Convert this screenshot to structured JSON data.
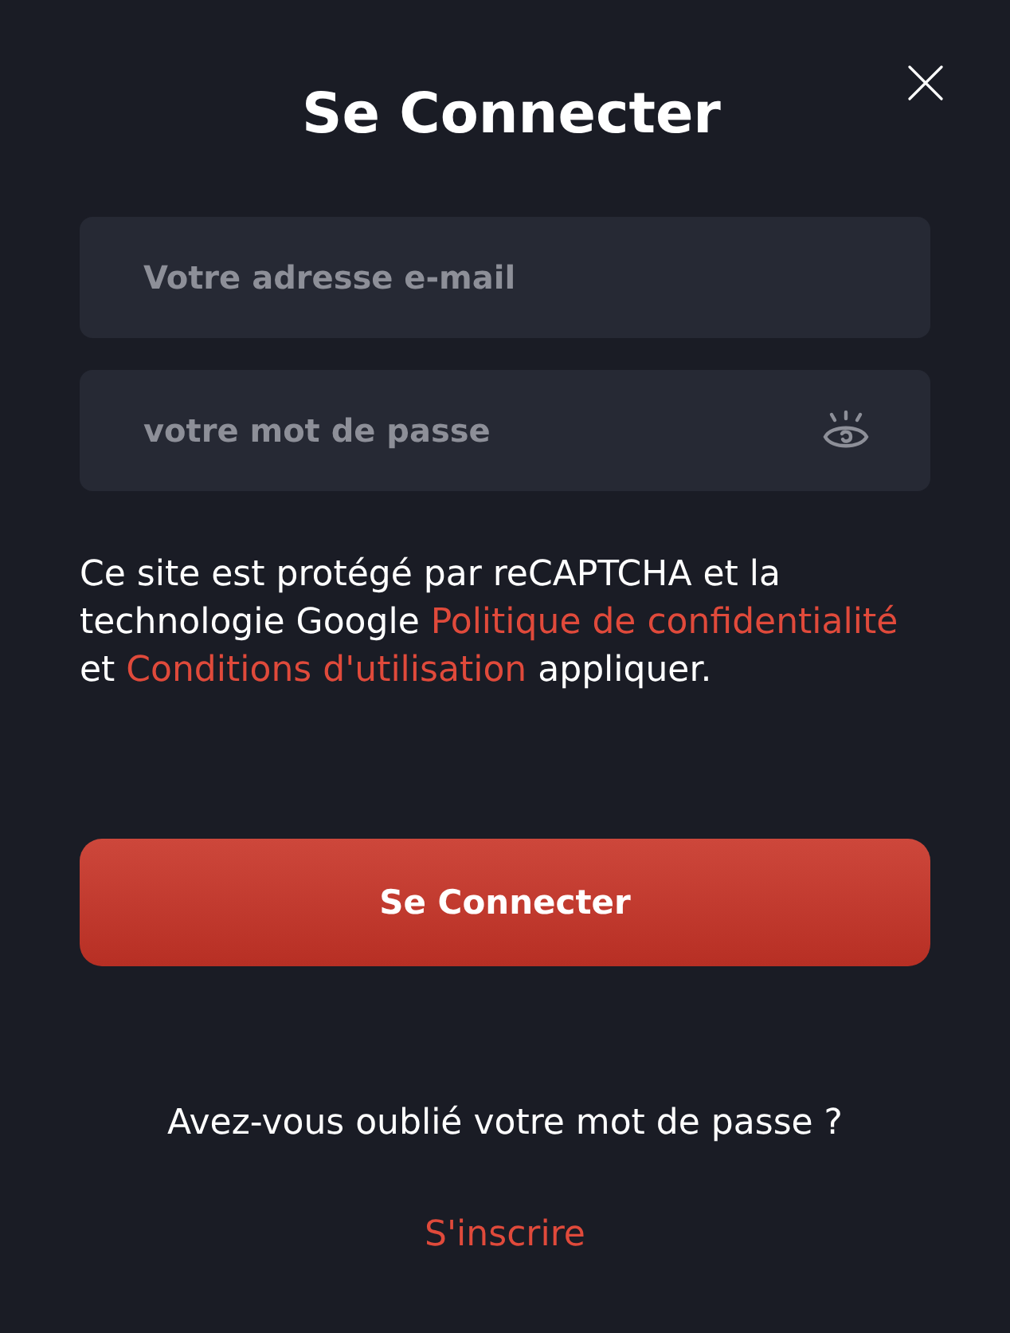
{
  "title": "Se Connecter",
  "fields": [
    {
      "kind": "email",
      "placeholder": "Votre adresse e-mail"
    },
    {
      "kind": "password",
      "placeholder": "votre mot de passe"
    }
  ],
  "notice": {
    "text_before": "Ce site est protégé par reCAPTCHA et la technologie Google",
    "privacy_link": "Politique de confidentialité",
    "text_middle": "et",
    "terms_link": "Conditions d'utilisation",
    "text_after": "appliquer."
  },
  "submit_button": "Se Connecter",
  "forgot_password_link": "Avez-vous oublié votre mot de passe ?",
  "signup_link": "S'inscrire"
}
